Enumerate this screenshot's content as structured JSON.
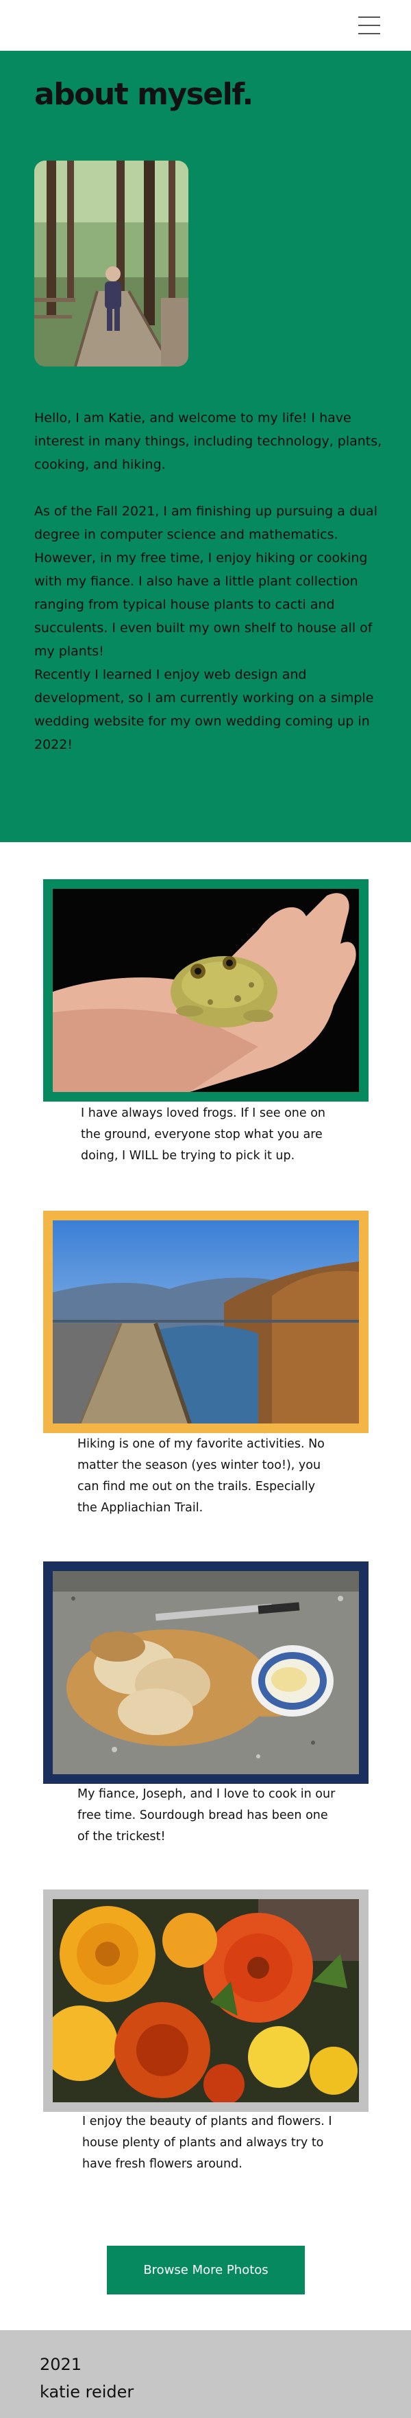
{
  "nav": {
    "menu_icon": "hamburger-menu-icon"
  },
  "about": {
    "title": "about myself.",
    "text": "Hello, I am Katie, and welcome to my life! I have interest in many things, including technology, plants, cooking, and hiking.\n\nAs of the Fall 2021, I am finishing up pursuing a dual degree in computer science and mathematics. However, in my free time, I enjoy hiking or cooking with my fiance. I also have a little plant collection ranging from typical house plants to cacti and succulents. I even built my own shelf to house all of my plants!\nRecently I learned I enjoy web design and development, so I am currently working on a simple wedding website for my own wedding coming up in 2022!"
  },
  "cards": [
    {
      "caption": "I have always loved frogs. If I see one on the ground, everyone stop what you are doing, I WILL be trying to pick it up.",
      "frame_color": "#06895e"
    },
    {
      "caption": "Hiking is one of my favorite activities. No matter the season (yes winter too!), you can find me out on the trails. Especially the Appliachian Trail.",
      "frame_color": "#f3b646"
    },
    {
      "caption": "My fiance, Joseph, and I love to cook in our free time. Sourdough bread has been one of the trickest!",
      "frame_color": "#1b2f5f"
    },
    {
      "caption": "I enjoy the beauty of plants and flowers. I house plenty of plants and always try to have fresh flowers around.",
      "frame_color": "#c2c2c2"
    }
  ],
  "browse_button": "Browse More Photos",
  "footer": {
    "year": "2021",
    "name": "katie reider"
  },
  "colors": {
    "green": "#06895e",
    "footer": "#c6c6c6"
  }
}
